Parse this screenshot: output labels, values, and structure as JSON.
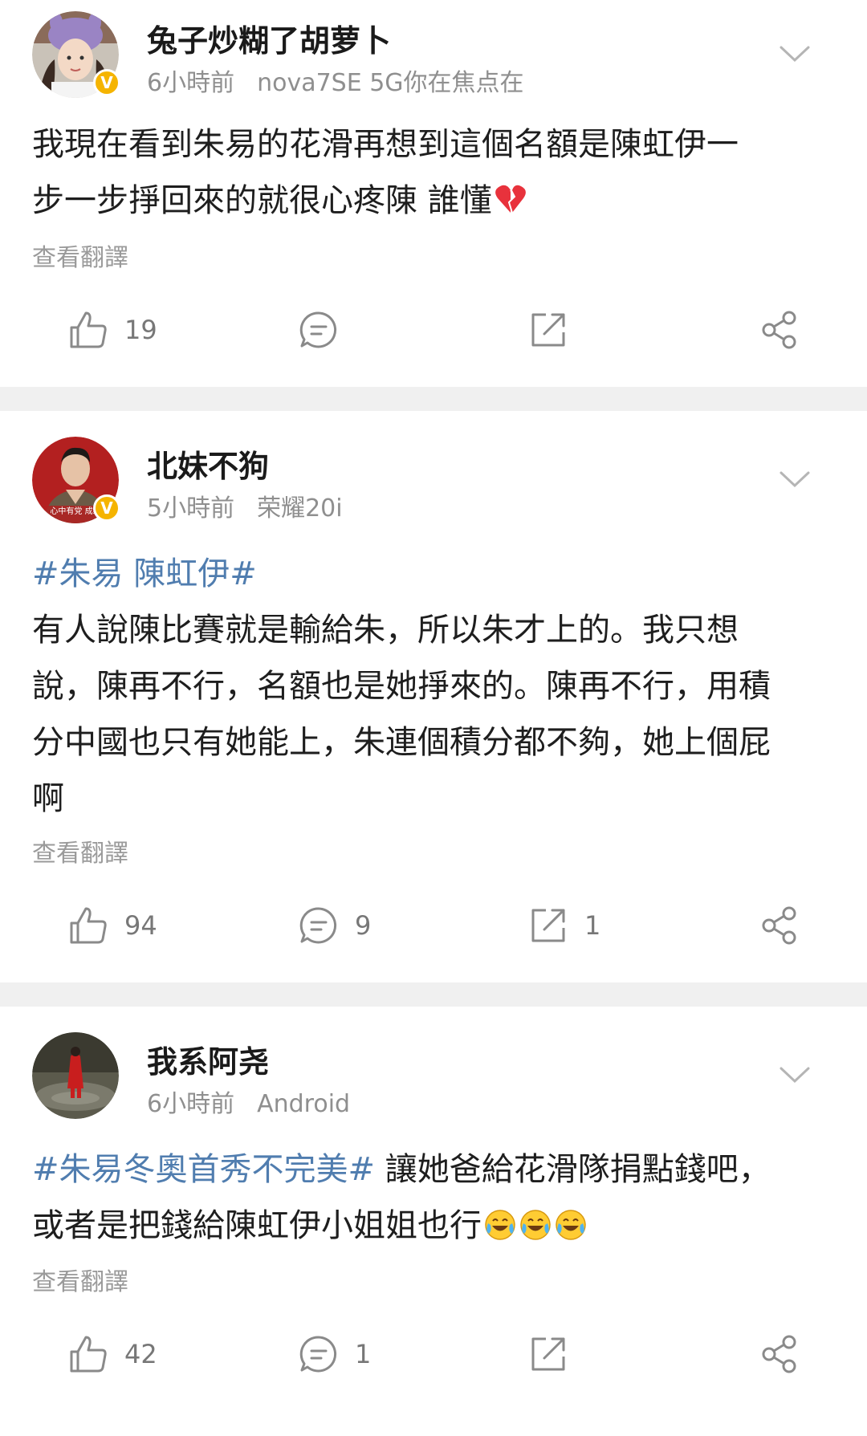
{
  "posts": [
    {
      "username": "兔子炒糊了胡萝卜",
      "time": "6小時前",
      "device": "nova7SE 5G你在焦点在",
      "content_lines": [
        "我現在看到朱易的花滑再想到這個名額是陳虹伊一",
        "步一步掙回來的就很心疼陳 誰懂"
      ],
      "translate": "查看翻譯",
      "likes": "19",
      "comments": "",
      "reposts": ""
    },
    {
      "username": "北妹不狗",
      "time": "5小時前",
      "device": "荣耀20i",
      "avatar_text": "心中有党 成绩",
      "topic": "#朱易 陳虹伊#",
      "content_lines": [
        "有人說陳比賽就是輸給朱，所以朱才上的。我只想",
        "說，陳再不行，名額也是她掙來的。陳再不行，用積",
        "分中國也只有她能上，朱連個積分都不夠，她上個屁",
        "啊"
      ],
      "translate": "查看翻譯",
      "likes": "94",
      "comments": "9",
      "reposts": "1"
    },
    {
      "username": "我系阿尧",
      "time": "6小時前",
      "device": "Android",
      "topic": "#朱易冬奧首秀不完美#",
      "content_line1_rest": " 讓她爸給花滑隊捐點錢吧，",
      "content_line2": "或者是把錢給陳虹伊小姐姐也行",
      "translate": "查看翻譯",
      "likes": "42",
      "comments": "1",
      "reposts": ""
    }
  ],
  "colors": {
    "topic": "#507daf",
    "separator": "#f0f0f0",
    "verified": "#f5b400",
    "meta": "#8f8f8f"
  },
  "icons": {
    "like": "thumbs-up-icon",
    "comment": "comment-bubble-icon",
    "repost": "repost-icon",
    "share": "share-icon",
    "more": "chevron-down-icon",
    "verified": "verified-badge-icon",
    "broken_heart": "broken-heart-emoji",
    "laugh_cry": "laugh-cry-emoji"
  }
}
